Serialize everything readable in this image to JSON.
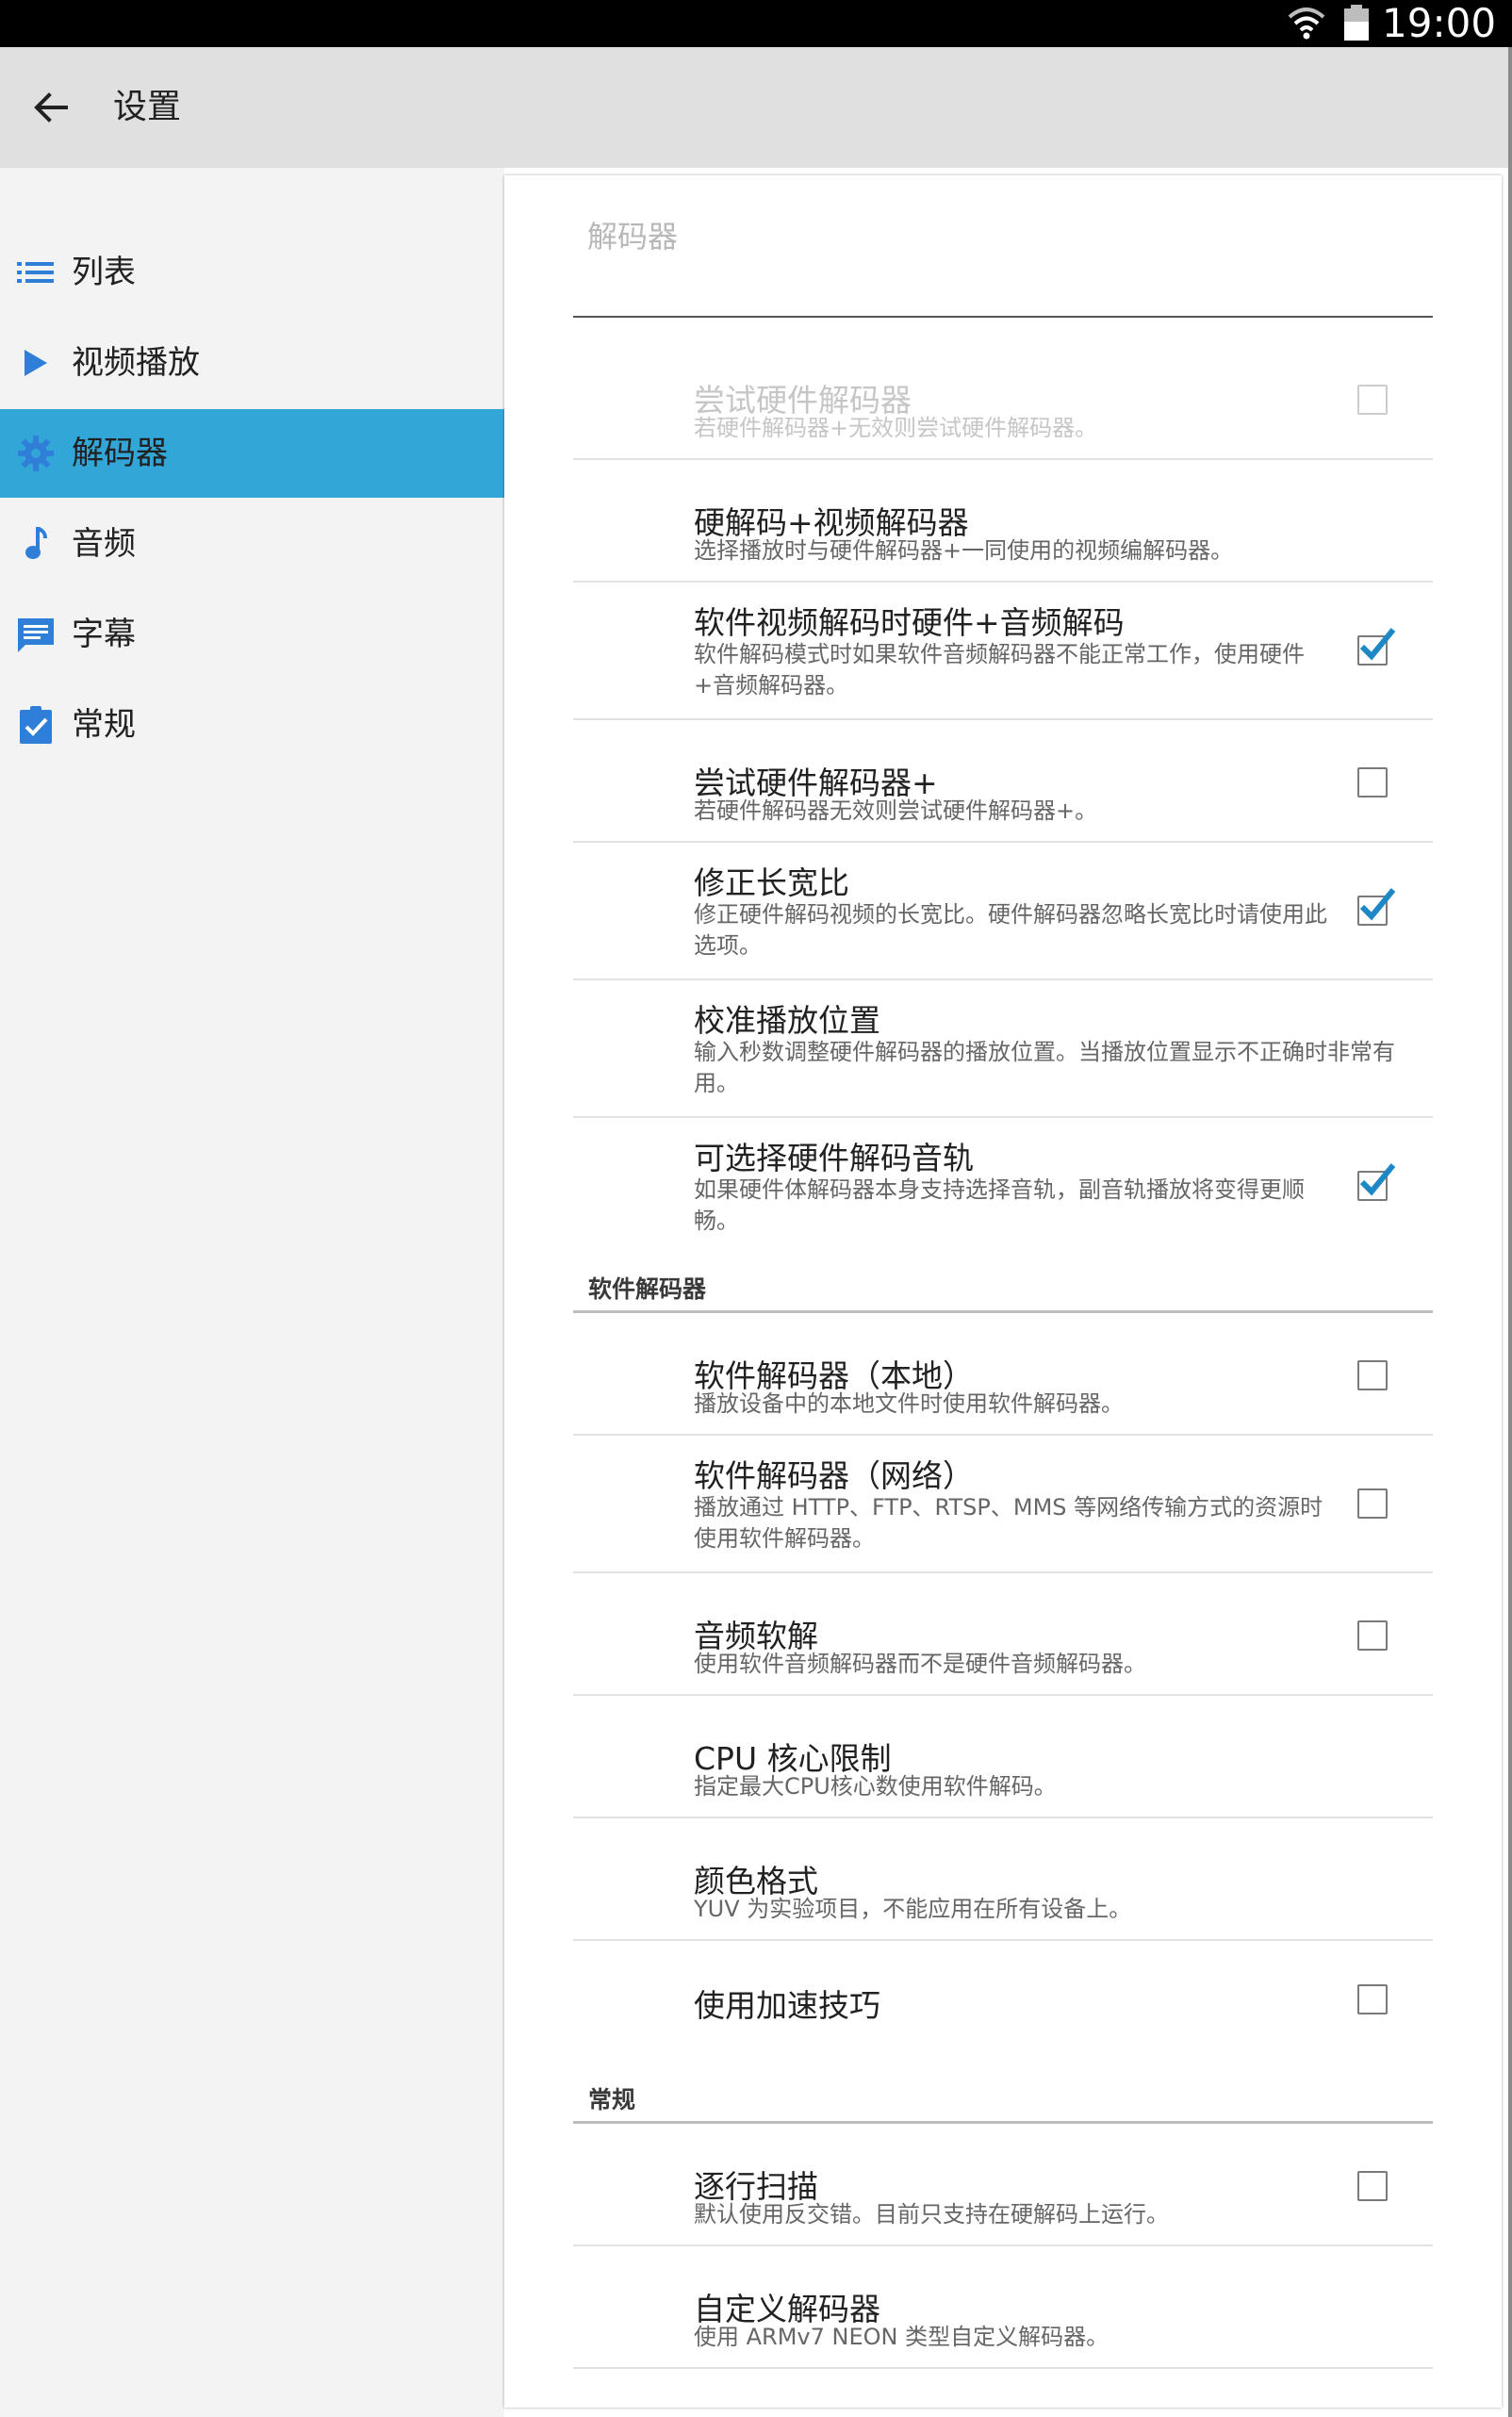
{
  "status_bar": {
    "time": "19:00"
  },
  "toolbar": {
    "title": "设置"
  },
  "sidebar": {
    "items": [
      {
        "label": "列表",
        "icon": "list-icon",
        "active": false
      },
      {
        "label": "视频播放",
        "icon": "play-icon",
        "active": false
      },
      {
        "label": "解码器",
        "icon": "gear-icon",
        "active": true
      },
      {
        "label": "音频",
        "icon": "music-note-icon",
        "active": false
      },
      {
        "label": "字幕",
        "icon": "subtitle-icon",
        "active": false
      },
      {
        "label": "常规",
        "icon": "clipboard-check-icon",
        "active": false
      }
    ]
  },
  "content": {
    "title": "解码器",
    "prefs": [
      {
        "title": "尝试硬件解码器",
        "summary": "若硬件解码器+无效则尝试硬件解码器。",
        "checkbox": true,
        "checked": false,
        "disabled": true
      },
      {
        "title": "硬解码+视频解码器",
        "summary": "选择播放时与硬件解码器+一同使用的视频编解码器。",
        "checkbox": false
      },
      {
        "title": "软件视频解码时硬件+音频解码",
        "summary": "软件解码模式时如果软件音频解码器不能正常工作，使用硬件+音频解码器。",
        "checkbox": true,
        "checked": true
      },
      {
        "title": "尝试硬件解码器+",
        "summary": "若硬件解码器无效则尝试硬件解码器+。",
        "checkbox": true,
        "checked": false
      },
      {
        "title": "修正长宽比",
        "summary": "修正硬件解码视频的长宽比。硬件解码器忽略长宽比时请使用此选项。",
        "checkbox": true,
        "checked": true
      },
      {
        "title": "校准播放位置",
        "summary": "输入秒数调整硬件解码器的播放位置。当播放位置显示不正确时非常有用。",
        "checkbox": false
      },
      {
        "title": "可选择硬件解码音轨",
        "summary": "如果硬件体解码器本身支持选择音轨，副音轨播放将变得更顺畅。",
        "checkbox": true,
        "checked": true
      }
    ],
    "software_section": {
      "header": "软件解码器",
      "prefs": [
        {
          "title": "软件解码器（本地）",
          "summary": "播放设备中的本地文件时使用软件解码器。",
          "checkbox": true,
          "checked": false
        },
        {
          "title": "软件解码器（网络）",
          "summary": "播放通过 HTTP、FTP、RTSP、MMS 等网络传输方式的资源时使用软件解码器。",
          "checkbox": true,
          "checked": false
        },
        {
          "title": "音频软解",
          "summary": "使用软件音频解码器而不是硬件音频解码器。",
          "checkbox": true,
          "checked": false
        },
        {
          "title": "CPU 核心限制",
          "summary": "指定最大CPU核心数使用软件解码。",
          "checkbox": false
        },
        {
          "title": "颜色格式",
          "summary": "YUV 为实验项目，不能应用在所有设备上。",
          "checkbox": false
        },
        {
          "title": "使用加速技巧",
          "summary": "",
          "checkbox": true,
          "checked": false
        }
      ]
    },
    "general_section": {
      "header": "常规",
      "prefs": [
        {
          "title": "逐行扫描",
          "summary": "默认使用反交错。目前只支持在硬解码上运行。",
          "checkbox": true,
          "checked": false
        },
        {
          "title": "自定义解码器",
          "summary": "使用 ARMv7 NEON 类型自定义解码器。",
          "checkbox": false
        }
      ]
    }
  },
  "colors": {
    "accent": "#33a6d8",
    "check": "#1e88c7",
    "icon_blue": "#2f7fd8",
    "toolbar_bg": "#e0e0e0",
    "sidebar_bg": "#f3f3f3"
  }
}
